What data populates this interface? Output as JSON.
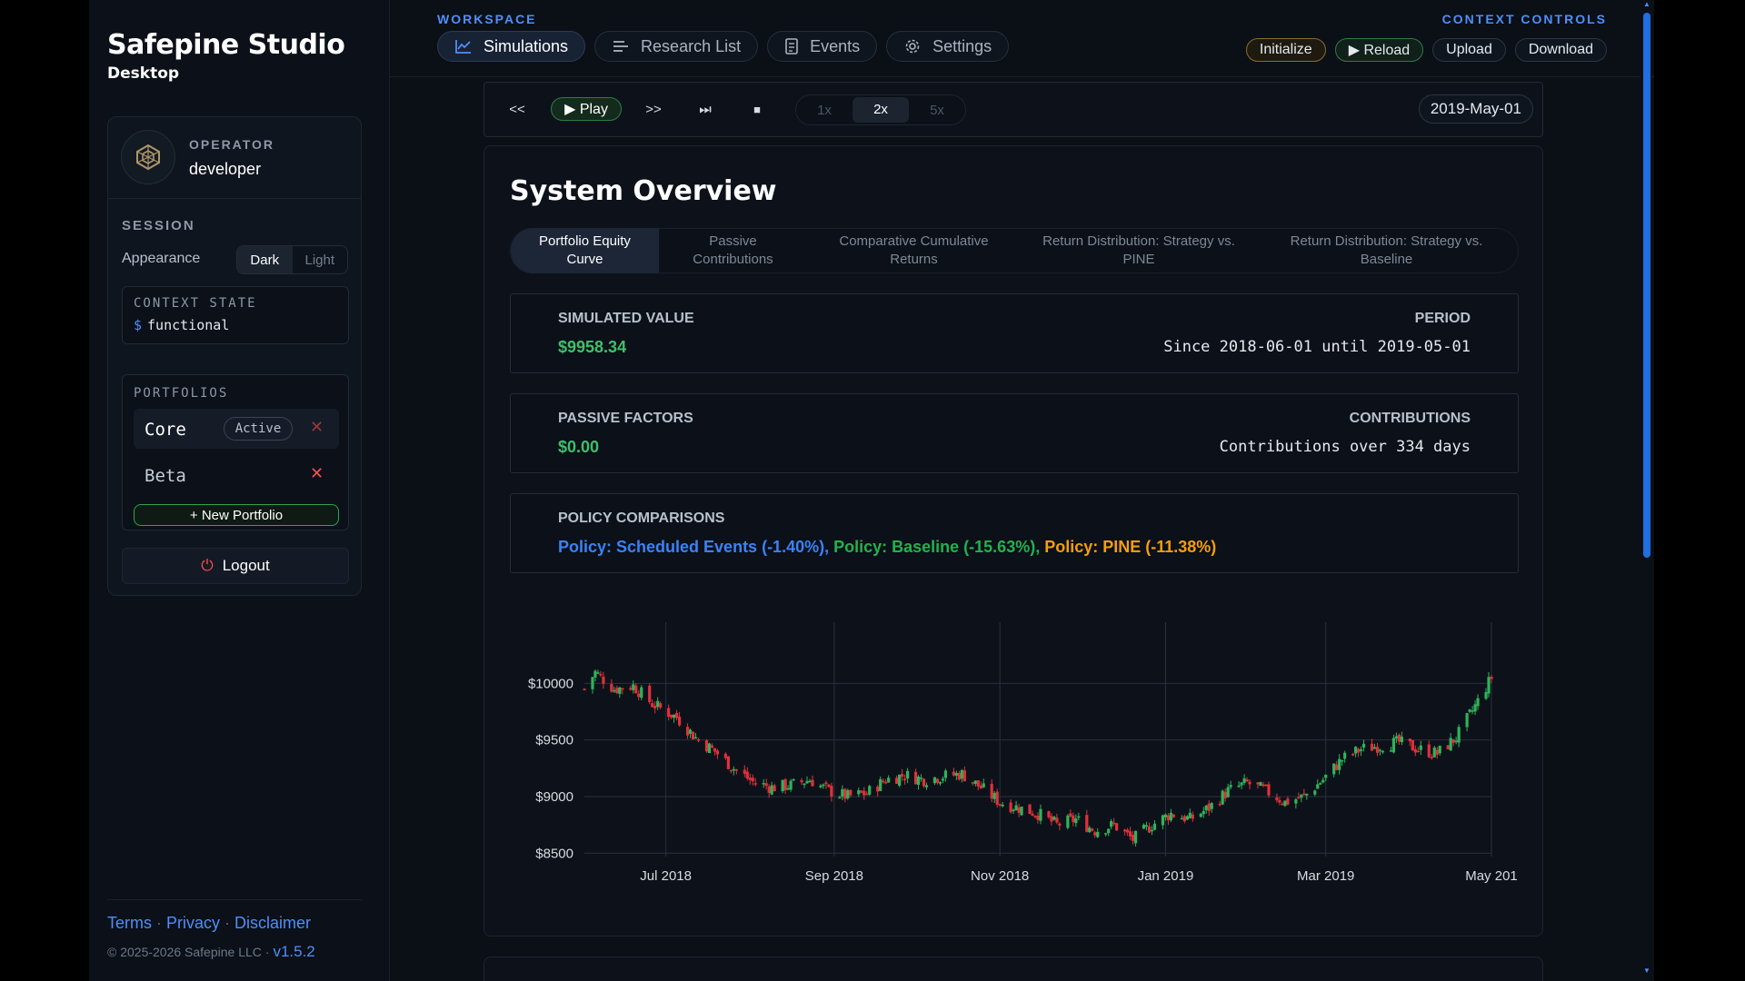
{
  "brand": {
    "title": "Safepine Studio",
    "subtitle": "Desktop"
  },
  "operator": {
    "label": "OPERATOR",
    "name": "developer"
  },
  "session": {
    "label": "SESSION",
    "appearance_label": "Appearance",
    "themes": [
      "Dark",
      "Light"
    ],
    "selected_theme": "Dark"
  },
  "context_state": {
    "label": "CONTEXT STATE",
    "prompt": "$",
    "value": "functional"
  },
  "portfolios": {
    "label": "PORTFOLIOS",
    "items": [
      {
        "name": "Core",
        "badge": "Active"
      },
      {
        "name": "Beta",
        "badge": ""
      }
    ],
    "new_label": "+ New Portfolio"
  },
  "logout_label": "Logout",
  "footer": {
    "links": [
      "Terms",
      "Privacy",
      "Disclaimer"
    ],
    "separator": "·",
    "copyright": "© 2025-2026 Safepine LLC ·",
    "version": "v1.5.2"
  },
  "workspace": {
    "label": "WORKSPACE",
    "tabs": [
      {
        "label": "Simulations",
        "icon": "chart-line-icon"
      },
      {
        "label": "Research List",
        "icon": "list-icon"
      },
      {
        "label": "Events",
        "icon": "document-icon"
      },
      {
        "label": "Settings",
        "icon": "gear-icon"
      }
    ],
    "active_tab": "Simulations"
  },
  "context_controls": {
    "label": "CONTEXT CONTROLS",
    "buttons": [
      "Initialize",
      "▶ Reload",
      "Upload",
      "Download"
    ]
  },
  "player": {
    "rewind": "<<",
    "play": "▶ Play",
    "forward": ">>",
    "skip_end": "⏭",
    "stop": "■",
    "speeds": [
      "1x",
      "2x",
      "5x"
    ],
    "selected_speed": "2x",
    "date": "2019-May-01"
  },
  "overview": {
    "title": "System Overview",
    "subtabs": [
      "Portfolio Equity Curve",
      "Passive Contributions",
      "Comparative Cumulative Returns",
      "Return Distribution: Strategy vs. PINE",
      "Return Distribution: Strategy vs. Baseline"
    ],
    "active_subtab": "Portfolio Equity Curve",
    "simulated_value": {
      "label": "SIMULATED VALUE",
      "value": "$9958.34"
    },
    "period": {
      "label": "PERIOD",
      "value": "Since 2018-06-01 until 2019-05-01"
    },
    "passive_factors": {
      "label": "PASSIVE FACTORS",
      "value": "$0.00"
    },
    "contributions": {
      "label": "CONTRIBUTIONS",
      "value": "Contributions over 334 days"
    },
    "policy_comparisons": {
      "label": "POLICY COMPARISONS",
      "items": [
        {
          "text": "Policy: Scheduled Events (-1.40%),",
          "color": "#3b82f6"
        },
        {
          "text": "Policy: Baseline (-15.63%),",
          "color": "#22b24c"
        },
        {
          "text": "Policy: PINE (-11.38%)",
          "color": "#f59e0b"
        }
      ]
    }
  },
  "colors": {
    "accent": "#4f8ff7",
    "up": "#2fb35a",
    "down": "#e0303a"
  },
  "chart_data": {
    "type": "candlestick",
    "yticks": [
      "$10000",
      "$9500",
      "$9000",
      "$8500"
    ],
    "ytick_values": [
      10000,
      9500,
      9000,
      8500
    ],
    "ylim": [
      8470,
      10300
    ],
    "xticks": [
      "Jul 2018",
      "Sep 2018",
      "Nov 2018",
      "Jan 2019",
      "Mar 2019",
      "May 201"
    ],
    "xtick_dates": [
      "2018-07-01",
      "2018-09-01",
      "2018-11-01",
      "2019-01-01",
      "2019-03-01",
      "2019-05-01"
    ],
    "x_start": "2018-06-01",
    "x_end": "2019-05-01",
    "grid": true,
    "close_points": [
      {
        "date": "2018-06-01",
        "value": 9950
      },
      {
        "date": "2018-06-05",
        "value": 10100
      },
      {
        "date": "2018-06-12",
        "value": 9950
      },
      {
        "date": "2018-06-19",
        "value": 9980
      },
      {
        "date": "2018-06-26",
        "value": 9820
      },
      {
        "date": "2018-07-05",
        "value": 9700
      },
      {
        "date": "2018-07-12",
        "value": 9520
      },
      {
        "date": "2018-07-19",
        "value": 9400
      },
      {
        "date": "2018-07-26",
        "value": 9250
      },
      {
        "date": "2018-08-02",
        "value": 9130
      },
      {
        "date": "2018-08-09",
        "value": 9080
      },
      {
        "date": "2018-08-16",
        "value": 9100
      },
      {
        "date": "2018-08-23",
        "value": 9150
      },
      {
        "date": "2018-08-30",
        "value": 9050
      },
      {
        "date": "2018-09-06",
        "value": 9000
      },
      {
        "date": "2018-09-13",
        "value": 9030
      },
      {
        "date": "2018-09-20",
        "value": 9150
      },
      {
        "date": "2018-09-27",
        "value": 9190
      },
      {
        "date": "2018-10-04",
        "value": 9150
      },
      {
        "date": "2018-10-11",
        "value": 9180
      },
      {
        "date": "2018-10-18",
        "value": 9200
      },
      {
        "date": "2018-10-25",
        "value": 9080
      },
      {
        "date": "2018-11-01",
        "value": 8950
      },
      {
        "date": "2018-11-08",
        "value": 8900
      },
      {
        "date": "2018-11-15",
        "value": 8850
      },
      {
        "date": "2018-11-22",
        "value": 8750
      },
      {
        "date": "2018-11-29",
        "value": 8800
      },
      {
        "date": "2018-12-06",
        "value": 8700
      },
      {
        "date": "2018-12-13",
        "value": 8750
      },
      {
        "date": "2018-12-20",
        "value": 8620
      },
      {
        "date": "2018-12-27",
        "value": 8750
      },
      {
        "date": "2019-01-03",
        "value": 8850
      },
      {
        "date": "2019-01-10",
        "value": 8800
      },
      {
        "date": "2019-01-17",
        "value": 8900
      },
      {
        "date": "2019-01-24",
        "value": 9050
      },
      {
        "date": "2019-01-31",
        "value": 9120
      },
      {
        "date": "2019-02-07",
        "value": 9050
      },
      {
        "date": "2019-02-14",
        "value": 8950
      },
      {
        "date": "2019-02-21",
        "value": 9000
      },
      {
        "date": "2019-02-28",
        "value": 9150
      },
      {
        "date": "2019-03-07",
        "value": 9330
      },
      {
        "date": "2019-03-14",
        "value": 9420
      },
      {
        "date": "2019-03-21",
        "value": 9450
      },
      {
        "date": "2019-03-28",
        "value": 9480
      },
      {
        "date": "2019-04-04",
        "value": 9420
      },
      {
        "date": "2019-04-11",
        "value": 9380
      },
      {
        "date": "2019-04-18",
        "value": 9520
      },
      {
        "date": "2019-04-25",
        "value": 9800
      },
      {
        "date": "2019-05-01",
        "value": 10050
      }
    ]
  },
  "footer_card_stub": ""
}
